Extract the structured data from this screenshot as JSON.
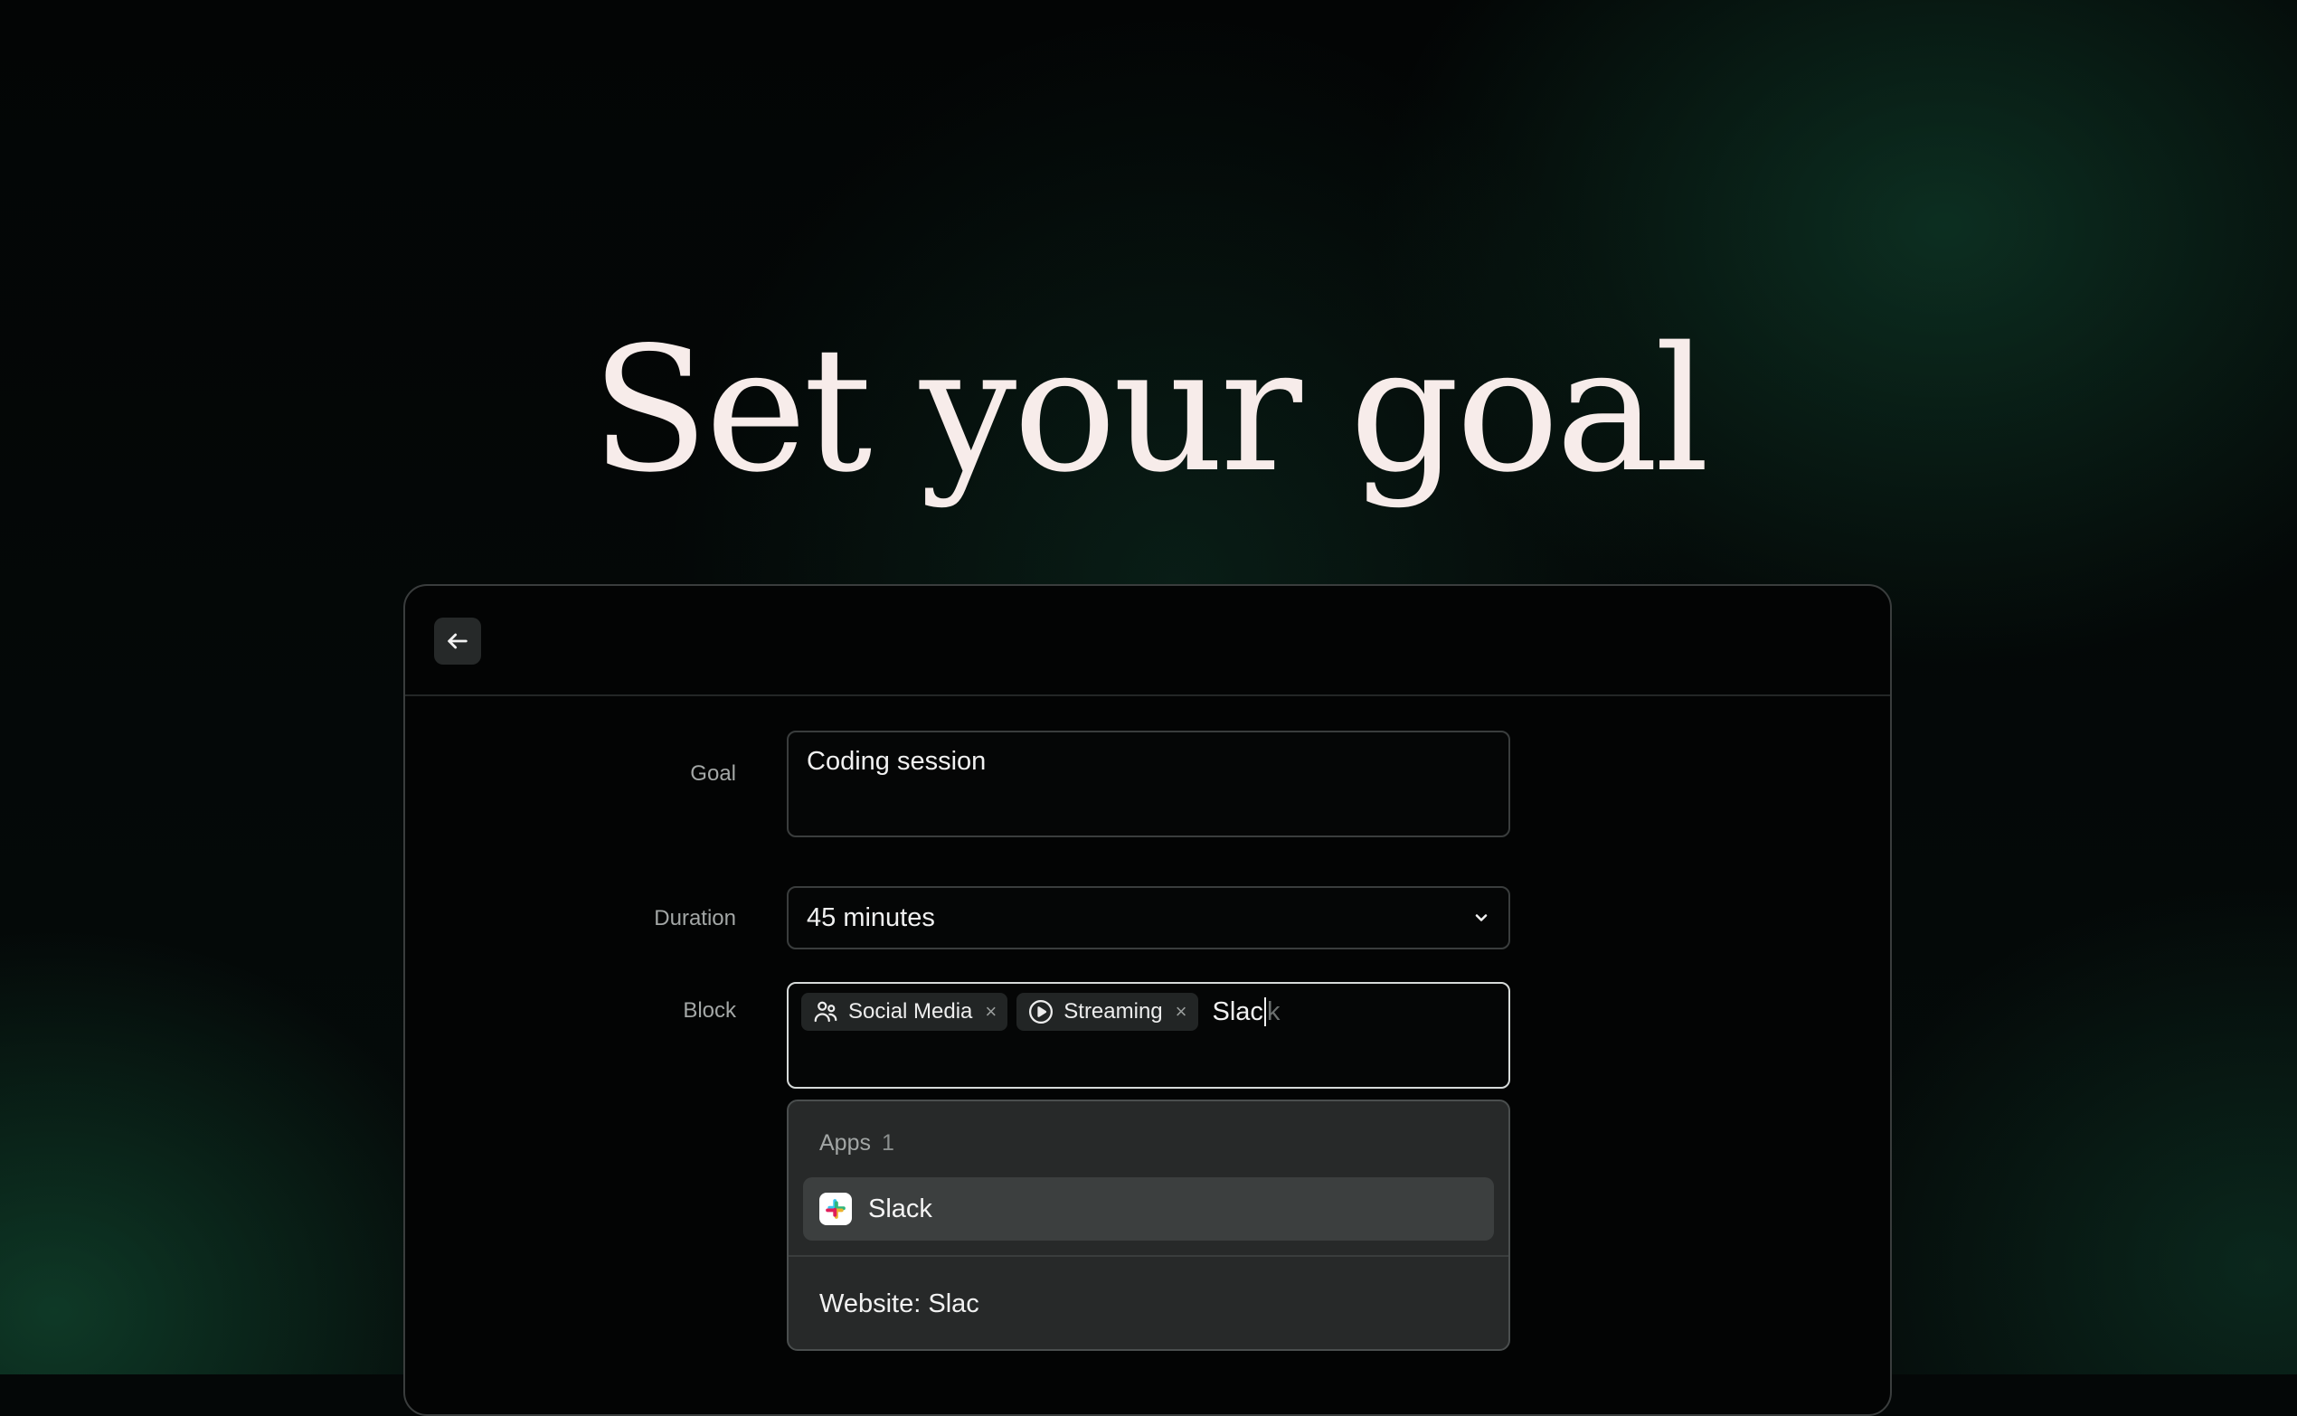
{
  "page": {
    "title": "Set your goal"
  },
  "window": {
    "back_icon": "arrow-left-icon",
    "form": {
      "goal": {
        "label": "Goal",
        "value": "Coding session"
      },
      "duration": {
        "label": "Duration",
        "value": "45 minutes",
        "icon": "chevron-down-icon"
      },
      "block": {
        "label": "Block",
        "chips": [
          {
            "label": "Social Media",
            "icon": "users-icon",
            "remove": "×"
          },
          {
            "label": "Streaming",
            "icon": "play-circle-icon",
            "remove": "×"
          }
        ],
        "typed": "Slac",
        "autocomplete_ghost": "k"
      }
    },
    "dropdown": {
      "section_label": "Apps",
      "section_count": "1",
      "items": [
        {
          "label": "Slack",
          "icon": "slack-icon"
        }
      ],
      "website_option": "Website: Slac"
    }
  },
  "colors": {
    "background": "#040707",
    "accent_green": "#145037",
    "panel": "#272929",
    "highlight": "#3c3f3f"
  }
}
